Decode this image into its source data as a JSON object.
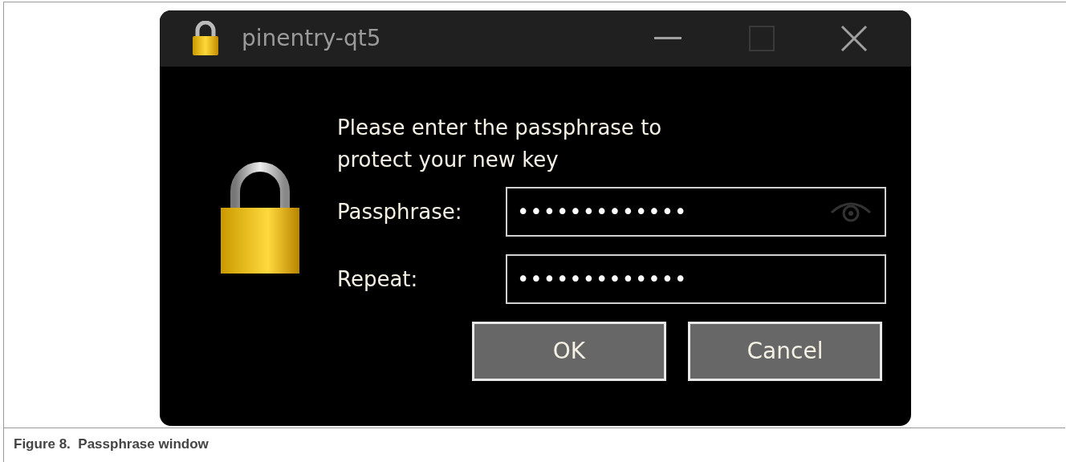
{
  "window": {
    "title": "pinentry-qt5",
    "maximize_disabled": true
  },
  "dialog": {
    "message": "Please enter the passphrase to protect your new key",
    "fields": [
      {
        "label": "Passphrase:",
        "value": "•••••••••••••",
        "show_eye": true
      },
      {
        "label": "Repeat:",
        "value": "•••••••••••••",
        "show_eye": false
      }
    ],
    "buttons": [
      "OK",
      "Cancel"
    ]
  },
  "caption": "Figure 8.  Passphrase window"
}
